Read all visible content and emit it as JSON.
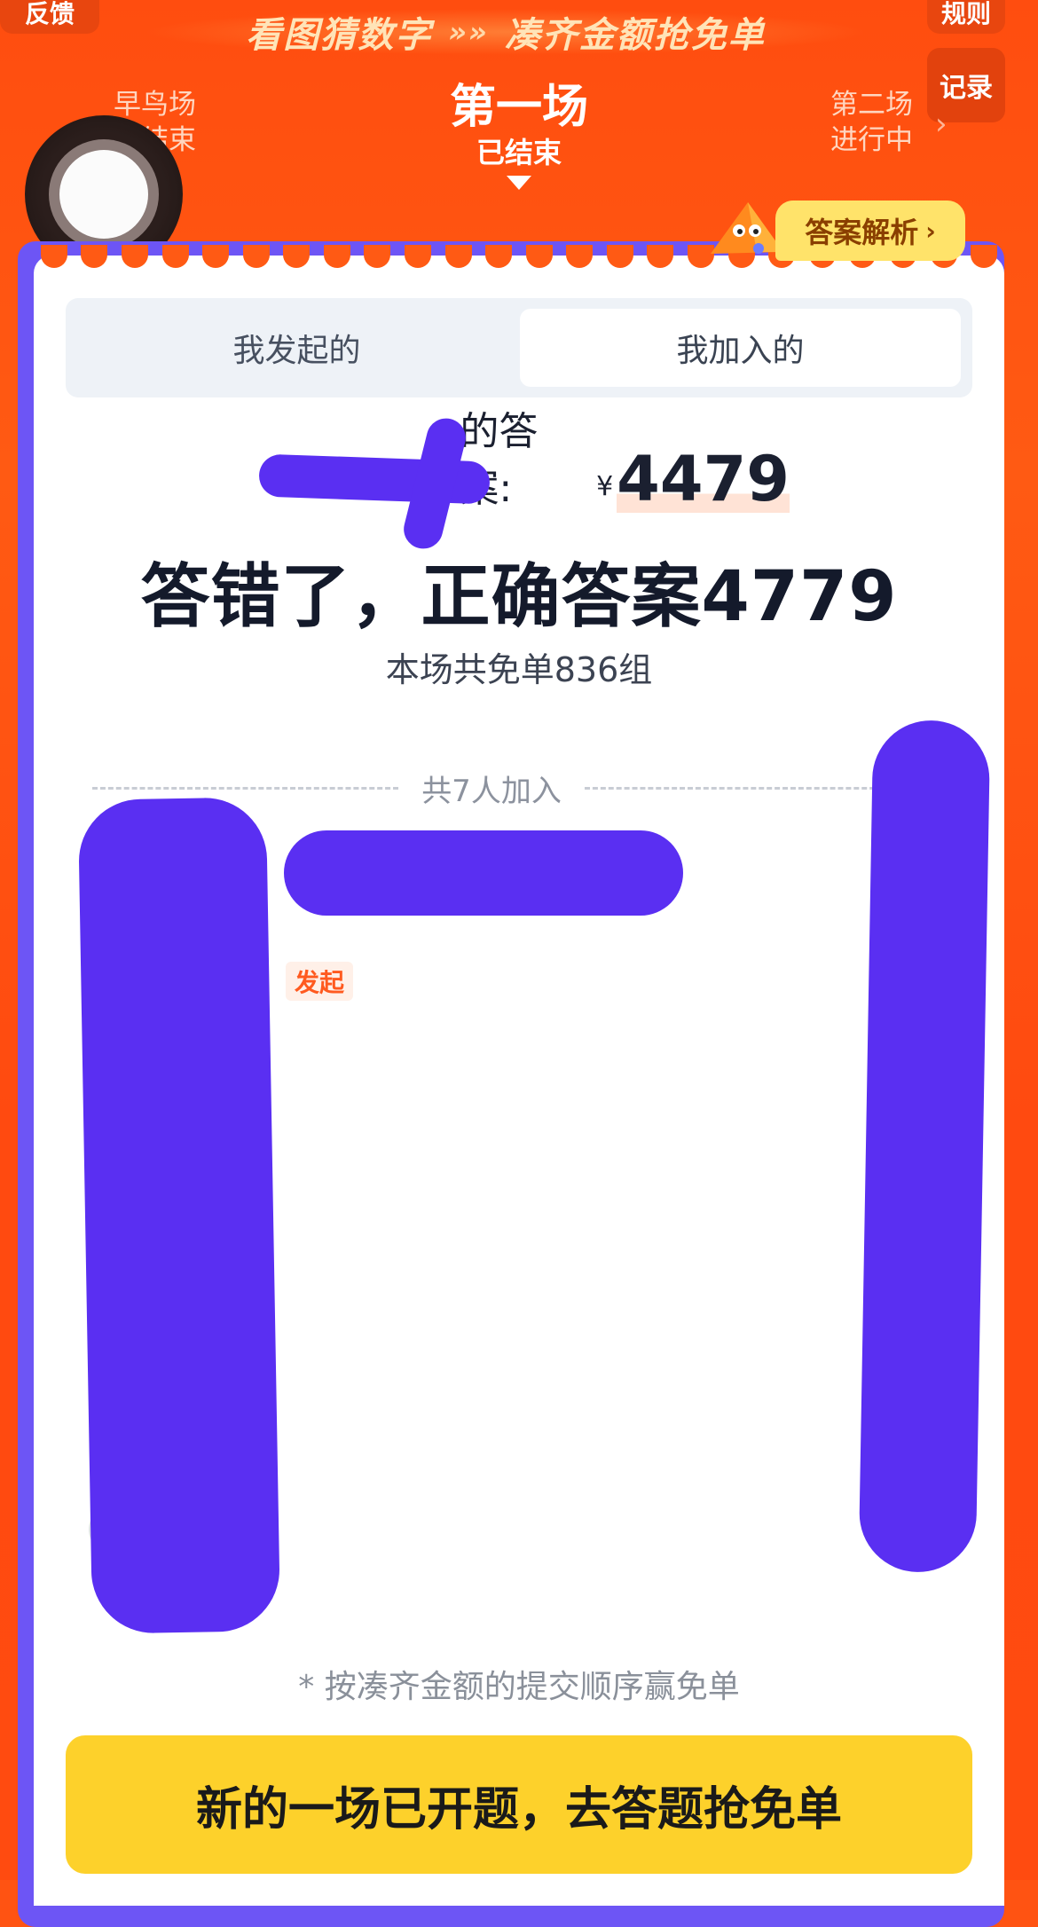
{
  "header": {
    "feedback_label": "反馈",
    "rules_label": "规则",
    "record_label": "记录",
    "banner_left": "看图猜数字",
    "banner_chevrons": "»»",
    "banner_right": "凑齐金额抢免单"
  },
  "rounds": {
    "previous": {
      "name": "早鸟场",
      "status": "已结束"
    },
    "current": {
      "name": "第一场",
      "status": "已结束"
    },
    "next": {
      "name": "第二场",
      "status": "进行中"
    }
  },
  "answer_analysis_label": "答案解析",
  "tabs": [
    {
      "label": "我发起的",
      "selected": false
    },
    {
      "label": "我加入的",
      "selected": true
    }
  ],
  "my_answer": {
    "label_suffix": "的答案:",
    "currency": "¥",
    "value": "4479"
  },
  "result_text": "答错了，正确答案4779",
  "summary_text": "本场共免单836组",
  "participants_label": "共7人加入",
  "participants": [
    {
      "tag": "",
      "price": "¥",
      "price_color": "#ff6a1c"
    },
    {
      "tag": "发起",
      "price": "¥",
      "price_color": "#222222"
    },
    {
      "tag": "",
      "price": "",
      "price_color": "#222222"
    },
    {
      "tag": "",
      "price": "¥",
      "price_color": "#222222"
    },
    {
      "tag": "",
      "price": "",
      "price_color": "#222222"
    },
    {
      "tag": "",
      "price": "¥",
      "price_color": "#222222"
    },
    {
      "tag": "",
      "price": "",
      "price_color": "#222222"
    }
  ],
  "note_text": "* 按凑齐金额的提交顺序赢免单",
  "cta_label": "新的一场已开题，去答题抢免单"
}
